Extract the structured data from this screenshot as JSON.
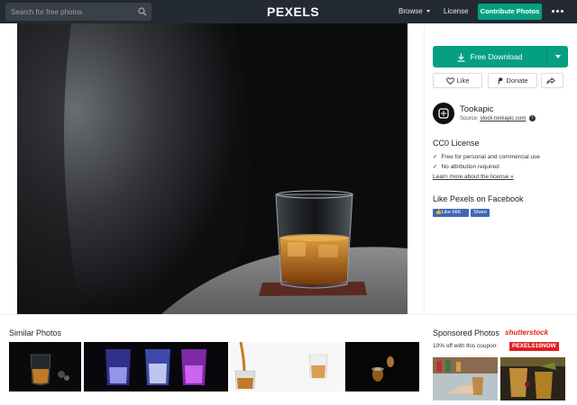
{
  "header": {
    "search_placeholder": "Search for free photos",
    "logo": "PEXELS",
    "browse_label": "Browse",
    "license_label": "License",
    "contribute_label": "Contribute Photos"
  },
  "actions": {
    "download_label": "Free Download",
    "like_label": "Like",
    "donate_label": "Donate"
  },
  "author": {
    "name": "Tookapic",
    "source_prefix": "Source:",
    "source_link": "stock.tookapic.com",
    "info_glyph": "i"
  },
  "license": {
    "title": "CC0 License",
    "items": [
      "Free for personal and commercial use",
      "No attribution required"
    ],
    "link": "Learn more about the license »"
  },
  "facebook": {
    "title": "Like Pexels on Facebook",
    "like_label": "Like 66K",
    "share_label": "Share"
  },
  "similar": {
    "title": "Similar Photos"
  },
  "sponsored": {
    "title": "Sponsored Photos",
    "brand": "shutterstock",
    "coupon_text": "10% off with this coupon:",
    "coupon_code": "PEXELS10NOW"
  },
  "colors": {
    "accent": "#05a081",
    "topbar": "#232a34",
    "facebook": "#4267b2",
    "coupon": "#e02020"
  }
}
